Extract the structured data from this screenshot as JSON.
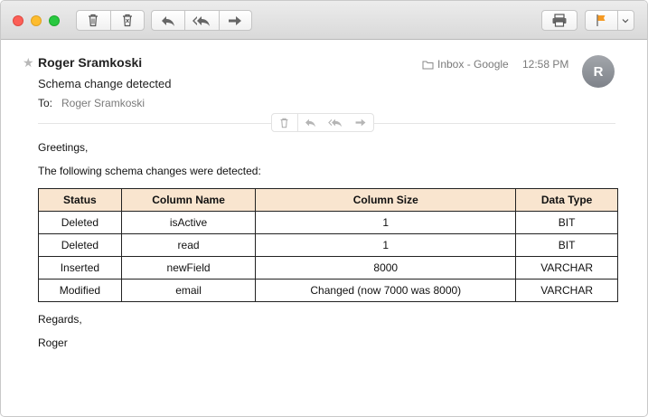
{
  "toolbar": {
    "buttons": [
      "delete",
      "junk",
      "reply",
      "reply-all",
      "forward",
      "print",
      "flag"
    ]
  },
  "message": {
    "sender": "Roger Sramkoski",
    "subject": "Schema change detected",
    "to_label": "To:",
    "to_value": "Roger Sramkoski",
    "mailbox": "Inbox - Google",
    "time": "12:58 PM",
    "avatar_initial": "R"
  },
  "email_body": {
    "greeting": "Greetings,",
    "intro": "The following schema changes were detected:",
    "closing": "Regards,",
    "signature": "Roger"
  },
  "schema_table": {
    "headers": [
      "Status",
      "Column Name",
      "Column Size",
      "Data Type"
    ],
    "rows": [
      [
        "Deleted",
        "isActive",
        "1",
        "BIT"
      ],
      [
        "Deleted",
        "read",
        "1",
        "BIT"
      ],
      [
        "Inserted",
        "newField",
        "8000",
        "VARCHAR"
      ],
      [
        "Modified",
        "email",
        "Changed (now 7000 was 8000)",
        "VARCHAR"
      ]
    ]
  },
  "colors": {
    "header_bg": "#f9e5cf",
    "flag": "#f59a23",
    "close": "#fc5f57",
    "minimize": "#fdbc2e",
    "zoom": "#28c840"
  }
}
